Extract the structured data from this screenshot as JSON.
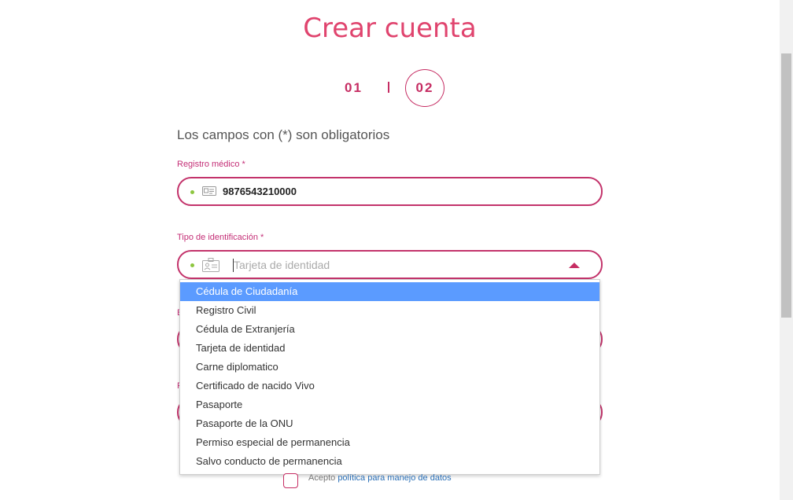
{
  "title": "Crear cuenta",
  "steps": {
    "step1": "01",
    "step2": "02",
    "current": 2
  },
  "required_note": "Los campos con (*) son obligatorios",
  "registro": {
    "label": "Registro médico *",
    "value": "9876543210000",
    "icon": "id-card-icon"
  },
  "tipo": {
    "label": "Tipo de identificación *",
    "placeholder": "Tarjeta de identidad",
    "icon": "id-badge-icon",
    "expanded": true
  },
  "dropdown": {
    "options": [
      "Cédula de Ciudadanía",
      "Registro Civil",
      "Cédula de Extranjería",
      "Tarjeta de identidad",
      "Carne diplomatico",
      "Certificado de nacido Vivo",
      "Pasaporte",
      "Pasaporte de la ONU",
      "Permiso especial de permanencia",
      "Salvo conducto de permanencia"
    ],
    "highlighted": "Cédula de Ciudadanía"
  },
  "consent": {
    "prefix": "Acepto ",
    "link": "política para manejo de datos"
  },
  "colors": {
    "brand": "#c62d63",
    "title": "#e0446e",
    "highlight": "#5b9bff",
    "dot": "#8dc63f"
  }
}
